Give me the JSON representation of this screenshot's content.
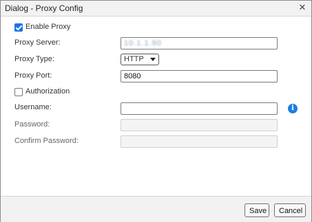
{
  "dialog": {
    "title": "Dialog - Proxy Config",
    "close_glyph": "✕"
  },
  "form": {
    "enable_proxy": {
      "label": "Enable Proxy",
      "checked": true
    },
    "proxy_server": {
      "label": "Proxy Server:",
      "value": "10.1.1.90"
    },
    "proxy_type": {
      "label": "Proxy Type:",
      "value": "HTTP"
    },
    "proxy_port": {
      "label": "Proxy Port:",
      "value": "8080"
    },
    "authorization": {
      "label": "Authorization",
      "checked": false
    },
    "username": {
      "label": "Username:",
      "value": ""
    },
    "password": {
      "label": "Password:",
      "value": ""
    },
    "confirm_password": {
      "label": "Confirm Password:",
      "value": ""
    },
    "info_glyph": "i"
  },
  "footer": {
    "save_label": "Save",
    "cancel_label": "Cancel"
  },
  "colors": {
    "accent": "#1a73e8",
    "info": "#1e7ee0"
  }
}
